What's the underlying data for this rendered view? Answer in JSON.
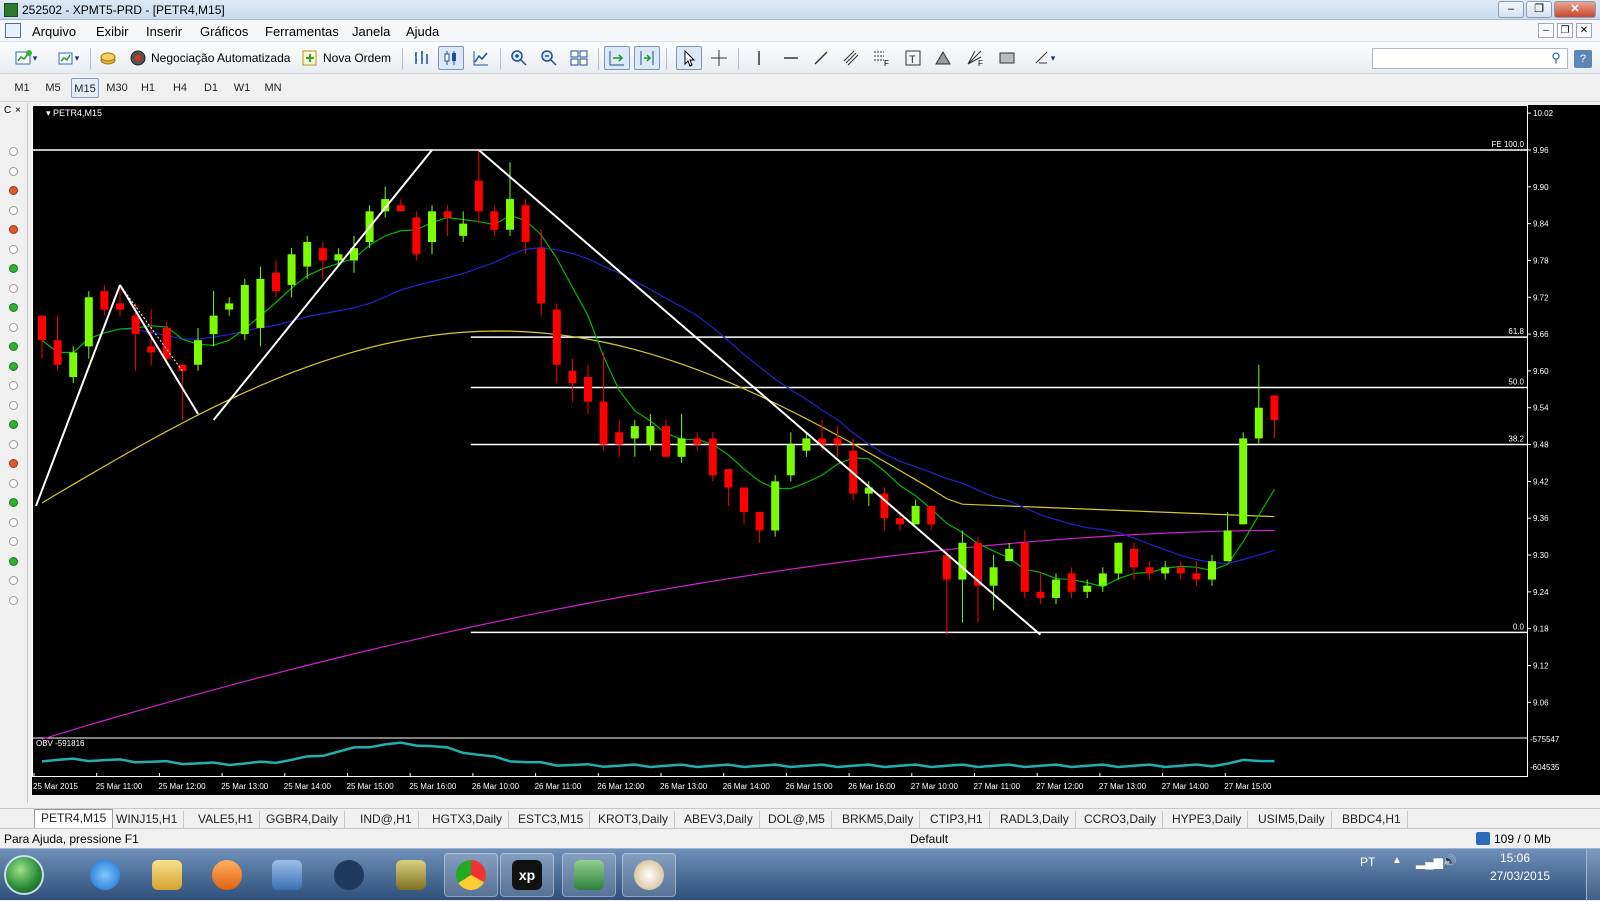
{
  "window": {
    "title": "252502 - XPMT5-PRD - [PETR4,M15]",
    "controls": [
      "–",
      "❐",
      "✕"
    ]
  },
  "menu": {
    "items": [
      "Arquivo",
      "Exibir",
      "Inserir",
      "Gráficos",
      "Ferramentas",
      "Janela",
      "Ajuda"
    ],
    "mdi_controls": [
      "–",
      "❐",
      "✕"
    ]
  },
  "toolbar": {
    "auto_trading": "Negociação Automatizada",
    "new_order": "Nova Ordem",
    "search_placeholder": ""
  },
  "timeframes": [
    "M1",
    "M5",
    "M15",
    "M30",
    "H1",
    "H4",
    "D1",
    "W1",
    "MN"
  ],
  "active_timeframe": "M15",
  "chart_data": {
    "type": "candlestick",
    "symbol_label": "PETR4,M15",
    "y_ticks": [
      "10.02",
      "9.96",
      "9.90",
      "9.84",
      "9.78",
      "9.72",
      "9.66",
      "9.60",
      "9.54",
      "9.48",
      "9.42",
      "9.36",
      "9.30",
      "9.24",
      "9.18",
      "9.12",
      "9.06"
    ],
    "ylim": [
      9.01,
      10.03
    ],
    "x_ticks": [
      "25 Mar 2015",
      "25 Mar 11:00",
      "25 Mar 12:00",
      "25 Mar 13:00",
      "25 Mar 14:00",
      "25 Mar 15:00",
      "25 Mar 16:00",
      "26 Mar 10:00",
      "26 Mar 11:00",
      "26 Mar 12:00",
      "26 Mar 13:00",
      "26 Mar 14:00",
      "26 Mar 15:00",
      "26 Mar 16:00",
      "27 Mar 10:00",
      "27 Mar 11:00",
      "27 Mar 12:00",
      "27 Mar 13:00",
      "27 Mar 14:00",
      "27 Mar 15:00"
    ],
    "fib_levels": [
      {
        "label": "FE 100.0",
        "value": 9.96
      },
      {
        "label": "61.8",
        "value": 9.655
      },
      {
        "label": "50.0",
        "value": 9.573
      },
      {
        "label": "38.2",
        "value": 9.48
      },
      {
        "label": "0.0",
        "value": 9.174
      }
    ],
    "candles": [
      [
        9.69,
        9.65,
        9.62,
        9.69
      ],
      [
        9.65,
        9.61,
        9.6,
        9.69
      ],
      [
        9.59,
        9.63,
        9.58,
        9.64
      ],
      [
        9.64,
        9.72,
        9.62,
        9.73
      ],
      [
        9.73,
        9.7,
        9.69,
        9.74
      ],
      [
        9.71,
        9.7,
        9.69,
        9.74
      ],
      [
        9.69,
        9.66,
        9.6,
        9.71
      ],
      [
        9.64,
        9.63,
        9.61,
        9.7
      ],
      [
        9.67,
        9.62,
        9.61,
        9.68
      ],
      [
        9.61,
        9.6,
        9.52,
        9.61
      ],
      [
        9.61,
        9.65,
        9.6,
        9.67
      ],
      [
        9.66,
        9.69,
        9.64,
        9.73
      ],
      [
        9.7,
        9.71,
        9.69,
        9.72
      ],
      [
        9.66,
        9.74,
        9.65,
        9.75
      ],
      [
        9.67,
        9.75,
        9.64,
        9.77
      ],
      [
        9.76,
        9.73,
        9.72,
        9.78
      ],
      [
        9.74,
        9.79,
        9.72,
        9.8
      ],
      [
        9.77,
        9.81,
        9.75,
        9.82
      ],
      [
        9.8,
        9.78,
        9.75,
        9.81
      ],
      [
        9.78,
        9.79,
        9.77,
        9.8
      ],
      [
        9.78,
        9.8,
        9.76,
        9.82
      ],
      [
        9.81,
        9.86,
        9.8,
        9.87
      ],
      [
        9.86,
        9.88,
        9.85,
        9.9
      ],
      [
        9.87,
        9.86,
        9.86,
        9.88
      ],
      [
        9.85,
        9.79,
        9.78,
        9.86
      ],
      [
        9.81,
        9.86,
        9.79,
        9.87
      ],
      [
        9.86,
        9.85,
        9.82,
        9.87
      ],
      [
        9.82,
        9.84,
        9.81,
        9.86
      ],
      [
        9.91,
        9.86,
        9.84,
        9.96
      ],
      [
        9.86,
        9.83,
        9.82,
        9.87
      ],
      [
        9.83,
        9.88,
        9.82,
        9.94
      ],
      [
        9.87,
        9.81,
        9.79,
        9.88
      ],
      [
        9.8,
        9.71,
        9.69,
        9.83
      ],
      [
        9.7,
        9.61,
        9.58,
        9.71
      ],
      [
        9.6,
        9.58,
        9.55,
        9.62
      ],
      [
        9.59,
        9.55,
        9.53,
        9.61
      ],
      [
        9.55,
        9.48,
        9.47,
        9.63
      ],
      [
        9.5,
        9.48,
        9.46,
        9.52
      ],
      [
        9.49,
        9.51,
        9.46,
        9.52
      ],
      [
        9.48,
        9.51,
        9.47,
        9.53
      ],
      [
        9.51,
        9.46,
        9.46,
        9.52
      ],
      [
        9.46,
        9.49,
        9.45,
        9.53
      ],
      [
        9.49,
        9.48,
        9.47,
        9.5
      ],
      [
        9.49,
        9.43,
        9.42,
        9.5
      ],
      [
        9.44,
        9.41,
        9.38,
        9.44
      ],
      [
        9.41,
        9.37,
        9.35,
        9.41
      ],
      [
        9.37,
        9.34,
        9.32,
        9.37
      ],
      [
        9.34,
        9.42,
        9.33,
        9.43
      ],
      [
        9.43,
        9.48,
        9.42,
        9.5
      ],
      [
        9.47,
        9.49,
        9.46,
        9.5
      ],
      [
        9.49,
        9.48,
        9.47,
        9.52
      ],
      [
        9.49,
        9.48,
        9.46,
        9.51
      ],
      [
        9.47,
        9.4,
        9.39,
        9.49
      ],
      [
        9.4,
        9.41,
        9.38,
        9.42
      ],
      [
        9.4,
        9.36,
        9.34,
        9.41
      ],
      [
        9.36,
        9.35,
        9.34,
        9.37
      ],
      [
        9.35,
        9.38,
        9.35,
        9.39
      ],
      [
        9.38,
        9.35,
        9.34,
        9.38
      ],
      [
        9.3,
        9.26,
        9.17,
        9.31
      ],
      [
        9.26,
        9.32,
        9.19,
        9.34
      ],
      [
        9.32,
        9.25,
        9.19,
        9.33
      ],
      [
        9.25,
        9.28,
        9.21,
        9.3
      ],
      [
        9.29,
        9.31,
        9.29,
        9.32
      ],
      [
        9.32,
        9.24,
        9.23,
        9.34
      ],
      [
        9.24,
        9.23,
        9.22,
        9.27
      ],
      [
        9.23,
        9.26,
        9.22,
        9.27
      ],
      [
        9.27,
        9.24,
        9.23,
        9.28
      ],
      [
        9.24,
        9.25,
        9.23,
        9.26
      ],
      [
        9.25,
        9.27,
        9.24,
        9.28
      ],
      [
        9.27,
        9.32,
        9.26,
        9.32
      ],
      [
        9.31,
        9.28,
        9.26,
        9.32
      ],
      [
        9.28,
        9.27,
        9.26,
        9.29
      ],
      [
        9.27,
        9.28,
        9.26,
        9.29
      ],
      [
        9.28,
        9.27,
        9.26,
        9.29
      ],
      [
        9.27,
        9.26,
        9.25,
        9.29
      ],
      [
        9.26,
        9.29,
        9.25,
        9.3
      ],
      [
        9.29,
        9.34,
        9.29,
        9.37
      ],
      [
        9.35,
        9.49,
        9.35,
        9.5
      ],
      [
        9.49,
        9.54,
        9.48,
        9.61
      ],
      [
        9.56,
        9.52,
        9.49,
        9.56
      ]
    ],
    "indicator": {
      "label": "OBV -591816",
      "axis_labels": [
        "-575547",
        "-604535"
      ]
    }
  },
  "symbol_tabs": [
    "PETR4,M15",
    "WINJ15,H1",
    "VALE5,H1",
    "GGBR4,Daily",
    "IND@,H1",
    "HGTX3,Daily",
    "ESTC3,M15",
    "KROT3,Daily",
    "ABEV3,Daily",
    "DOL@,M5",
    "BRKM5,Daily",
    "CTIP3,H1",
    "RADL3,Daily",
    "CCRO3,Daily",
    "HYPE3,Daily",
    "USIM5,Daily",
    "BBDC4,H1"
  ],
  "status": {
    "help": "Para Ajuda, pressione F1",
    "profile": "Default",
    "traffic": "109 / 0 Mb"
  },
  "taskbar": {
    "lang": "PT",
    "time": "15:06",
    "date": "27/03/2015"
  },
  "colors": {
    "bull": "#7cfc00",
    "bear": "#ff0000",
    "ma_fast": "#00b800",
    "ma_mid": "#2222cc",
    "ma_slow": "#d4c82a",
    "ma_long": "#d020d0",
    "obv": "#20b0b0"
  }
}
